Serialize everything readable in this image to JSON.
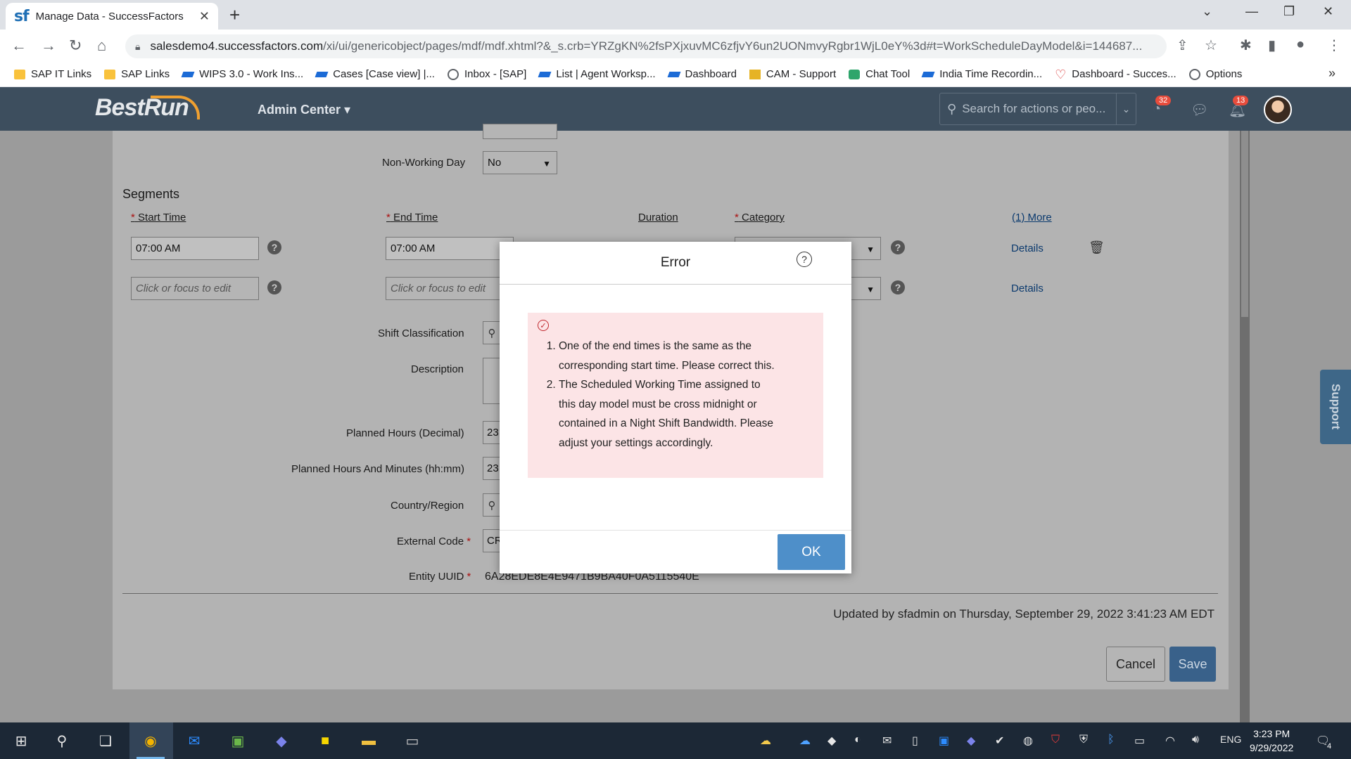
{
  "browser": {
    "tab_title": "Manage Data - SuccessFactors",
    "tab_favicon": "sf",
    "url_host": "salesdemo4.successfactors.com",
    "url_path": "/xi/ui/genericobject/pages/mdf/mdf.xhtml?&_s.crb=YRZgKN%2fsPXjxuvMC6zfjvY6un2UONmvyRgbr1WjL0eY%3d#t=WorkScheduleDayModel&i=144687...",
    "bookmarks": [
      {
        "label": "SAP IT Links",
        "icon": "folder-icon"
      },
      {
        "label": "SAP Links",
        "icon": "folder-icon"
      },
      {
        "label": "WIPS 3.0 - Work Ins...",
        "icon": "sap-icon"
      },
      {
        "label": "Cases [Case view] |...",
        "icon": "sap-icon"
      },
      {
        "label": "Inbox - [SAP]",
        "icon": "globe-icon"
      },
      {
        "label": "List | Agent Worksp...",
        "icon": "sap-icon"
      },
      {
        "label": "Dashboard",
        "icon": "sap-icon"
      },
      {
        "label": "CAM - Support",
        "icon": "cam-icon"
      },
      {
        "label": "Chat Tool",
        "icon": "chat-icon"
      },
      {
        "label": "India Time Recordin...",
        "icon": "sap-icon"
      },
      {
        "label": "Dashboard - Succes...",
        "icon": "heart-icon"
      },
      {
        "label": "Options",
        "icon": "globe-icon"
      }
    ],
    "bookmarks_more": "»"
  },
  "header": {
    "logo": "BestRun",
    "admin_center": "Admin Center",
    "search_placeholder": "Search for actions or peo...",
    "badge_approvals": "32",
    "badge_notifications": "13"
  },
  "form": {
    "non_working_day_label": "Non-Working Day",
    "non_working_day_value": "No",
    "segments_title": "Segments",
    "col_start_time": "Start Time",
    "col_end_time": "End Time",
    "col_duration": "Duration",
    "col_category": "Category",
    "col_more": "(1) More",
    "row1_start": "07:00 AM",
    "row1_end": "07:00 AM",
    "row2_placeholder": "Click or focus to edit",
    "details": "Details",
    "shift_classification_label": "Shift Classification",
    "description_label": "Description",
    "planned_hours_decimal_label": "Planned Hours (Decimal)",
    "planned_hours_decimal_value": "23.",
    "planned_hours_hhmm_label": "Planned Hours And Minutes (hh:mm)",
    "planned_hours_hhmm_value": "23:",
    "country_region_label": "Country/Region",
    "external_code_label": "External Code",
    "external_code_value": "CR",
    "entity_uuid_label": "Entity UUID",
    "entity_uuid_value": "6A28EDE8E4E9471B9BA40F0A5115540E",
    "required_marker": "*",
    "updated_text": "Updated by sfadmin on Thursday, September 29, 2022 3:41:23 AM EDT",
    "cancel": "Cancel",
    "save": "Save",
    "support": "Support"
  },
  "dialog": {
    "title": "Error",
    "messages": [
      "One of the end times is the same as the corresponding start time. Please correct this.",
      "The Scheduled Working Time assigned to this day model must be cross midnight or contained in a Night Shift Bandwidth. Please adjust your settings accordingly."
    ],
    "ok": "OK"
  },
  "taskbar": {
    "lang": "ENG",
    "time": "3:23 PM",
    "date": "9/29/2022",
    "notif_count": "4"
  }
}
